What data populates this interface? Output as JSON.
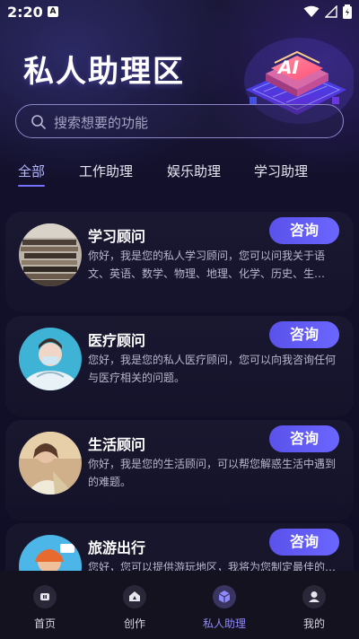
{
  "status_bar": {
    "time": "2:20",
    "notification_badge": "A"
  },
  "header": {
    "title": "私人助理区",
    "illustration_text": "AI"
  },
  "search": {
    "placeholder": "搜索想要的功能"
  },
  "tabs": [
    {
      "label": "全部",
      "active": true
    },
    {
      "label": "工作助理",
      "active": false
    },
    {
      "label": "娱乐助理",
      "active": false
    },
    {
      "label": "学习助理",
      "active": false
    }
  ],
  "cards": [
    {
      "title": "学习顾问",
      "button": "咨询",
      "desc": "你好，我是您的私人学习顾问，您可以问我关于语文、英语、数学、物理、地理、化学、历史、生…",
      "avatar_icon": "books-photo-icon"
    },
    {
      "title": "医疗顾问",
      "button": "咨询",
      "desc": "您好，我是您的私人医疗顾问，您可以向我咨询任何与医疗相关的问题。",
      "avatar_icon": "doctor-photo-icon"
    },
    {
      "title": "生活顾问",
      "button": "咨询",
      "desc": "你好，我是您的生活顾问，可以帮您解惑生活中遇到的难题。",
      "avatar_icon": "person-photo-icon"
    },
    {
      "title": "旅游出行",
      "button": "咨询",
      "desc": "您好，您可以提供游玩地区，我将为您制定最佳的…",
      "avatar_icon": "travel-photo-icon"
    }
  ],
  "bottom_nav": [
    {
      "label": "首页",
      "icon": "home-icon",
      "active": false
    },
    {
      "label": "创作",
      "icon": "create-icon",
      "active": false
    },
    {
      "label": "私人助理",
      "icon": "assistant-icon",
      "active": true
    },
    {
      "label": "我的",
      "icon": "profile-icon",
      "active": false
    }
  ],
  "colors": {
    "accent": "#6b66ff",
    "background": "#100e24",
    "nav_background": "#14121f"
  }
}
